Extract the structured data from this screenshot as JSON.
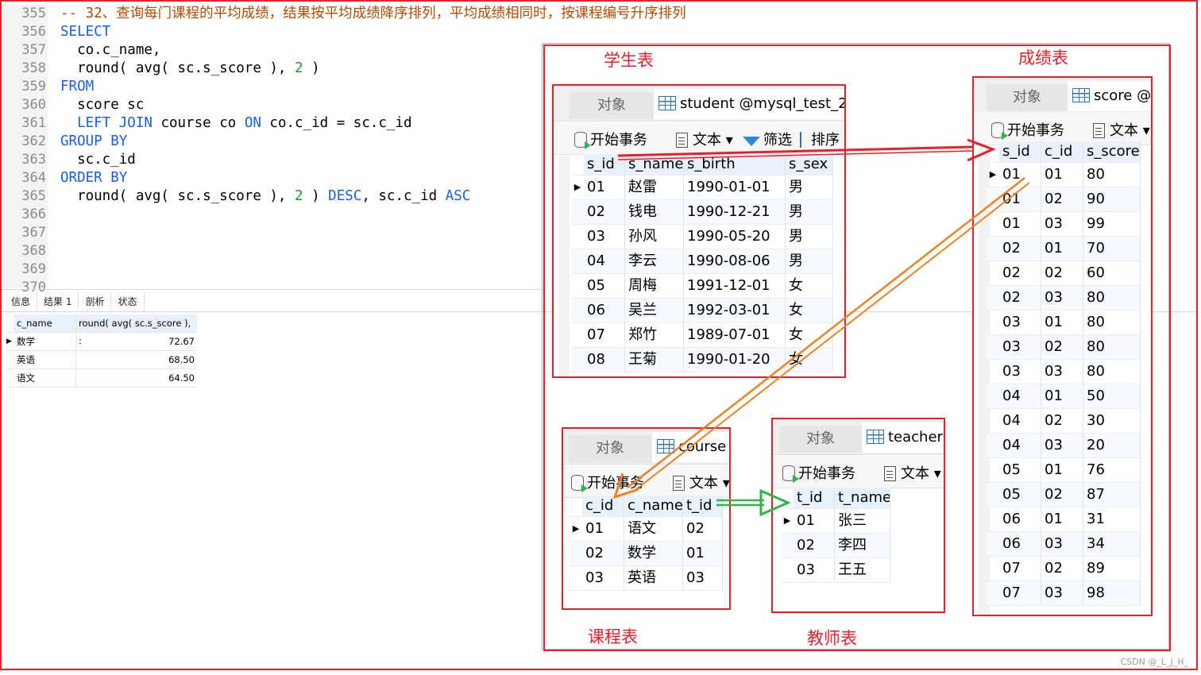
{
  "editor": {
    "line_numbers": [
      "355",
      "356",
      "357",
      "358",
      "359",
      "360",
      "361",
      "362",
      "363",
      "364",
      "365",
      "366",
      "367",
      "368",
      "369",
      "370"
    ],
    "lines": [
      [
        {
          "t": "-- 32、查询每门课程的平均成绩，结果按平均成绩降序排列，平均成绩相同时，按课程编号升序排列",
          "c": "cmt"
        }
      ],
      [
        {
          "t": "SELECT",
          "c": "kw"
        }
      ],
      [
        {
          "t": "  co.c_name,",
          "c": ""
        }
      ],
      [
        {
          "t": "  round( avg( sc.s_score ), ",
          "c": ""
        },
        {
          "t": "2",
          "c": "num"
        },
        {
          "t": " )",
          "c": ""
        }
      ],
      [
        {
          "t": "FROM",
          "c": "kw"
        }
      ],
      [
        {
          "t": "  score sc",
          "c": ""
        }
      ],
      [
        {
          "t": "  ",
          "c": ""
        },
        {
          "t": "LEFT JOIN",
          "c": "kw"
        },
        {
          "t": " course co ",
          "c": ""
        },
        {
          "t": "ON",
          "c": "kw"
        },
        {
          "t": " co.c_id = sc.c_id",
          "c": ""
        }
      ],
      [
        {
          "t": "GROUP BY",
          "c": "kw"
        }
      ],
      [
        {
          "t": "  sc.c_id",
          "c": ""
        }
      ],
      [
        {
          "t": "ORDER BY",
          "c": "kw"
        }
      ],
      [
        {
          "t": "  round( avg( sc.s_score ), ",
          "c": ""
        },
        {
          "t": "2",
          "c": "num"
        },
        {
          "t": " ) ",
          "c": ""
        },
        {
          "t": "DESC",
          "c": "kw"
        },
        {
          "t": ", sc.c_id ",
          "c": ""
        },
        {
          "t": "ASC",
          "c": "kw"
        }
      ]
    ]
  },
  "result_tabs": [
    "信息",
    "结果 1",
    "剖析",
    "状态"
  ],
  "result": {
    "columns": [
      "c_name",
      "round( avg( sc.s_score ), :"
    ],
    "rows": [
      [
        "数学",
        "72.67"
      ],
      [
        "英语",
        "68.50"
      ],
      [
        "语文",
        "64.50"
      ]
    ]
  },
  "captions": {
    "student": "学生表",
    "score": "成绩表",
    "course": "课程表",
    "teacher": "教师表"
  },
  "common": {
    "object_tab": "对象",
    "begin_tx": "开始事务",
    "text": "文本",
    "filter": "筛选",
    "sort": "排序"
  },
  "student": {
    "tab": "student @mysql_test_2(",
    "columns": [
      "s_id",
      "s_name",
      "s_birth",
      "s_sex"
    ],
    "rows": [
      [
        "01",
        "赵雷",
        "1990-01-01",
        "男"
      ],
      [
        "02",
        "钱电",
        "1990-12-21",
        "男"
      ],
      [
        "03",
        "孙风",
        "1990-05-20",
        "男"
      ],
      [
        "04",
        "李云",
        "1990-08-06",
        "男"
      ],
      [
        "05",
        "周梅",
        "1991-12-01",
        "女"
      ],
      [
        "06",
        "吴兰",
        "1992-03-01",
        "女"
      ],
      [
        "07",
        "郑竹",
        "1989-07-01",
        "女"
      ],
      [
        "08",
        "王菊",
        "1990-01-20",
        "女"
      ]
    ]
  },
  "score": {
    "tab": "score @",
    "columns": [
      "s_id",
      "c_id",
      "s_score"
    ],
    "rows": [
      [
        "01",
        "01",
        "80"
      ],
      [
        "01",
        "02",
        "90"
      ],
      [
        "01",
        "03",
        "99"
      ],
      [
        "02",
        "01",
        "70"
      ],
      [
        "02",
        "02",
        "60"
      ],
      [
        "02",
        "03",
        "80"
      ],
      [
        "03",
        "01",
        "80"
      ],
      [
        "03",
        "02",
        "80"
      ],
      [
        "03",
        "03",
        "80"
      ],
      [
        "04",
        "01",
        "50"
      ],
      [
        "04",
        "02",
        "30"
      ],
      [
        "04",
        "03",
        "20"
      ],
      [
        "05",
        "01",
        "76"
      ],
      [
        "05",
        "02",
        "87"
      ],
      [
        "06",
        "01",
        "31"
      ],
      [
        "06",
        "03",
        "34"
      ],
      [
        "07",
        "02",
        "89"
      ],
      [
        "07",
        "03",
        "98"
      ]
    ]
  },
  "course": {
    "tab": "course (",
    "columns": [
      "c_id",
      "c_name",
      "t_id"
    ],
    "rows": [
      [
        "01",
        "语文",
        "02"
      ],
      [
        "02",
        "数学",
        "01"
      ],
      [
        "03",
        "英语",
        "03"
      ]
    ]
  },
  "teacher": {
    "tab": "teacher",
    "columns": [
      "t_id",
      "t_name"
    ],
    "rows": [
      [
        "01",
        "张三"
      ],
      [
        "02",
        "李四"
      ],
      [
        "03",
        "王五"
      ]
    ]
  },
  "watermark": "CSDN @_L_J_H_",
  "colors": {
    "annotation_red": "#e8202a",
    "arrow_orange": "#f08020",
    "arrow_green": "#2fb34a",
    "keyword_blue": "#1a5fe8"
  }
}
